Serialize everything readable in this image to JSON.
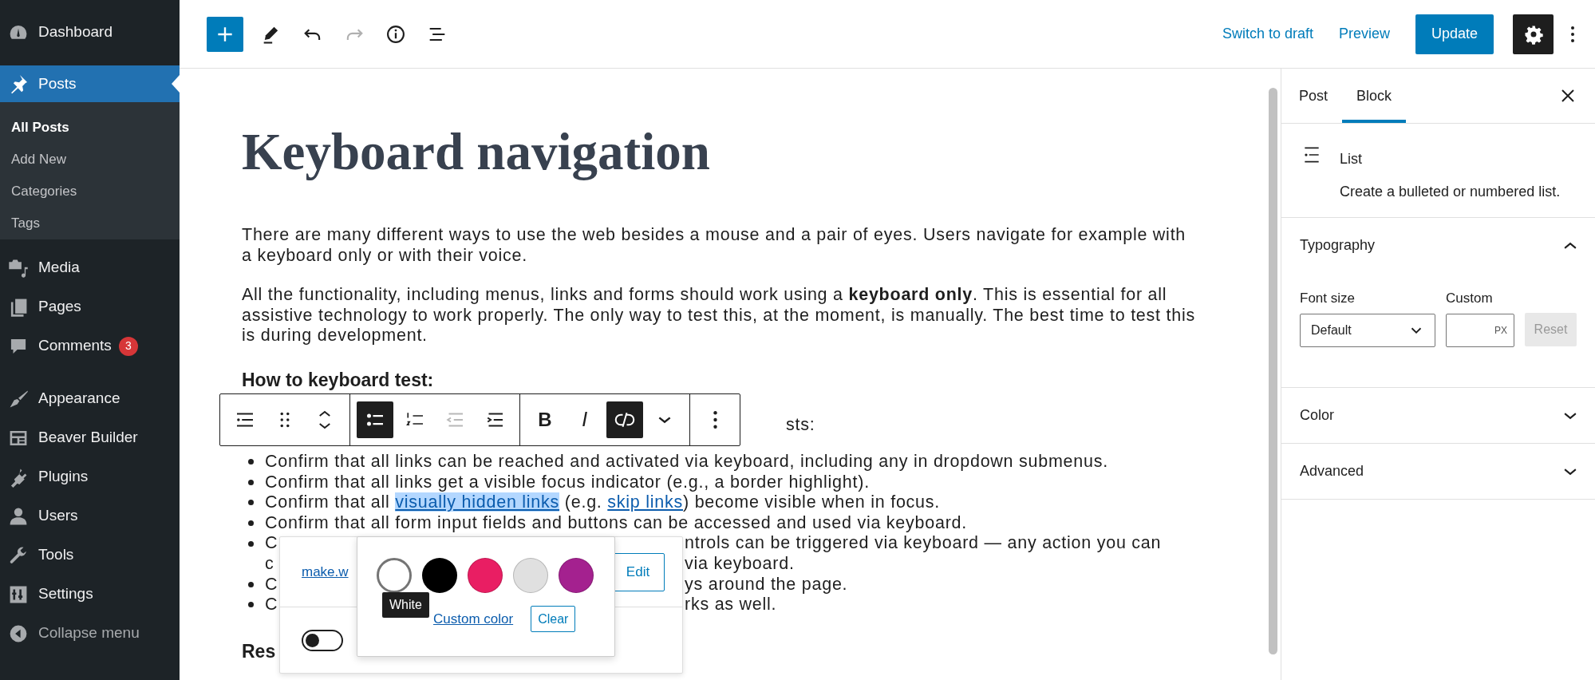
{
  "sidebar": {
    "items": [
      {
        "label": "Dashboard",
        "selected": false
      },
      {
        "label": "Posts",
        "selected": true,
        "children": [
          {
            "label": "All Posts",
            "selected": true
          },
          {
            "label": "Add New",
            "selected": false
          },
          {
            "label": "Categories",
            "selected": false
          },
          {
            "label": "Tags",
            "selected": false
          }
        ]
      },
      {
        "label": "Media",
        "selected": false
      },
      {
        "label": "Pages",
        "selected": false
      },
      {
        "label": "Comments",
        "selected": false,
        "badge": "3"
      },
      {
        "label": "Appearance",
        "selected": false
      },
      {
        "label": "Beaver Builder",
        "selected": false
      },
      {
        "label": "Plugins",
        "selected": false
      },
      {
        "label": "Users",
        "selected": false
      },
      {
        "label": "Tools",
        "selected": false
      },
      {
        "label": "Settings",
        "selected": false
      }
    ],
    "collapse": "Collapse menu"
  },
  "top_bar": {
    "undo": {
      "disabled": false
    },
    "redo": {
      "disabled": true
    },
    "links": [
      "Switch to draft",
      "Preview"
    ],
    "update": "Update",
    "settings": {
      "pressed": true
    }
  },
  "post": {
    "title": "Keyboard navigation",
    "paragraphs": [
      "There are many different ways to use the web besides a mouse and a pair of eyes.  Users navigate for example with a keyboard only or with their voice.",
      "All the functionality, including menus, links and forms should work using a **keyboard only**. This is essential for all assistive technology to work properly. The only way to test this, at the moment, is manually. The best time to test this is during development."
    ],
    "heading": "How to keyboard test:",
    "partial_paragraph": "sts:",
    "list": [
      {
        "kind": "plain",
        "text": "Confirm that all links can be reached and activated via keyboard, including any in dropdown submenus."
      },
      {
        "kind": "plain",
        "text": "Confirm that all links get a visible focus indicator (e.g., a border highlight)."
      },
      {
        "kind": "linked",
        "segments": [
          {
            "text": "Confirm that all ",
            "link": false,
            "selected": false
          },
          {
            "text": "visually hidden links",
            "link": true,
            "selected": true
          },
          {
            "text": " (e.g. ",
            "link": false,
            "selected": false
          },
          {
            "text": "skip links",
            "link": true,
            "selected": false
          },
          {
            "text": ") become visible when in focus.",
            "link": false,
            "selected": false
          }
        ]
      },
      {
        "kind": "plain",
        "text": "Confirm that all form input fields and buttons can be accessed and used via keyboard."
      },
      {
        "kind": "cut",
        "start": "C",
        "end": "ntrols can be triggered via keyboard — any action you can"
      },
      {
        "kind": "cut_continued",
        "start": "c",
        "end": "via keyboard."
      },
      {
        "kind": "cut",
        "start": "C",
        "end": "ys around the page."
      },
      {
        "kind": "cut",
        "start": "C",
        "end": "rks as well."
      }
    ],
    "heading_2": "Res"
  },
  "block_toolbar": {
    "groups": [
      [
        {
          "kind": "block-type",
          "active": false,
          "disabled": false
        },
        {
          "kind": "drag",
          "active": false,
          "disabled": false
        },
        {
          "kind": "mover",
          "active": false,
          "disabled": false
        }
      ],
      [
        {
          "kind": "bullets",
          "active": true,
          "disabled": false
        },
        {
          "kind": "numbers",
          "active": false,
          "disabled": false
        },
        {
          "kind": "outdent",
          "active": false,
          "disabled": true
        },
        {
          "kind": "indent",
          "active": false,
          "disabled": false
        }
      ],
      [
        {
          "kind": "bold",
          "label": "B",
          "active": false,
          "disabled": false
        },
        {
          "kind": "italic",
          "label": "I",
          "active": false,
          "disabled": false
        },
        {
          "kind": "unlink",
          "active": true,
          "disabled": false
        },
        {
          "kind": "more",
          "active": false,
          "disabled": false
        }
      ],
      [
        {
          "kind": "options",
          "active": false,
          "disabled": false
        }
      ]
    ]
  },
  "link_popover": {
    "url": "make.w",
    "toggle": {
      "on": false
    },
    "edit": "Edit",
    "color_picker": {
      "swatches": [
        {
          "color": "#ffffff",
          "selected": true
        },
        {
          "color": "#000000",
          "selected": false
        },
        {
          "color": "#e91e63",
          "selected": false
        },
        {
          "color": "#e0e0e0",
          "selected": false
        },
        {
          "color": "#a4218f",
          "selected": false
        }
      ],
      "tooltip": "White",
      "custom": "Custom color",
      "clear": "Clear"
    }
  },
  "settings_panel": {
    "tabs": [
      {
        "label": "Post",
        "selected": false
      },
      {
        "label": "Block",
        "selected": true
      }
    ],
    "block": {
      "name": "List",
      "description": "Create a bulleted or numbered list."
    },
    "sections": [
      {
        "title": "Typography",
        "expanded": true
      },
      {
        "title": "Color",
        "expanded": false
      },
      {
        "title": "Advanced",
        "expanded": false
      }
    ],
    "typography": {
      "font_size_label": "Font size",
      "font_size": "Default",
      "custom_label": "Custom",
      "unit": "PX",
      "reset": "Reset"
    }
  }
}
